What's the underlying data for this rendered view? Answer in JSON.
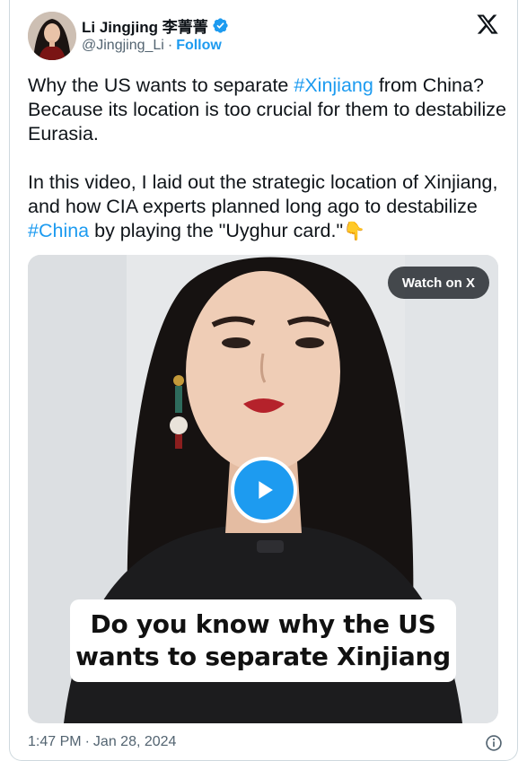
{
  "author": {
    "name": "Li Jingjing 李菁菁",
    "handle": "@Jingjing_Li",
    "separator": "·",
    "follow_label": "Follow"
  },
  "tweet": {
    "p1": {
      "before": "Why the US wants to separate ",
      "hashtag": "#Xinjiang",
      "after": " from China? Because its location is too crucial for them to destabilize Eurasia."
    },
    "p2": {
      "before": "In this video, I laid out the strategic location of Xinjiang, and how CIA experts planned long ago to destabilize ",
      "hashtag": "#China",
      "after": " by playing the \"Uyghur card.\"",
      "emoji": "👇"
    }
  },
  "media": {
    "watch_label": "Watch on X",
    "caption_line1": "Do you know why the US",
    "caption_line2": "wants to separate Xinjiang"
  },
  "footer": {
    "time": "1:47 PM",
    "separator": "·",
    "date": "Jan 28, 2024"
  },
  "colors": {
    "accent": "#1d9bf0",
    "text": "#0f1419",
    "muted": "#536471"
  }
}
